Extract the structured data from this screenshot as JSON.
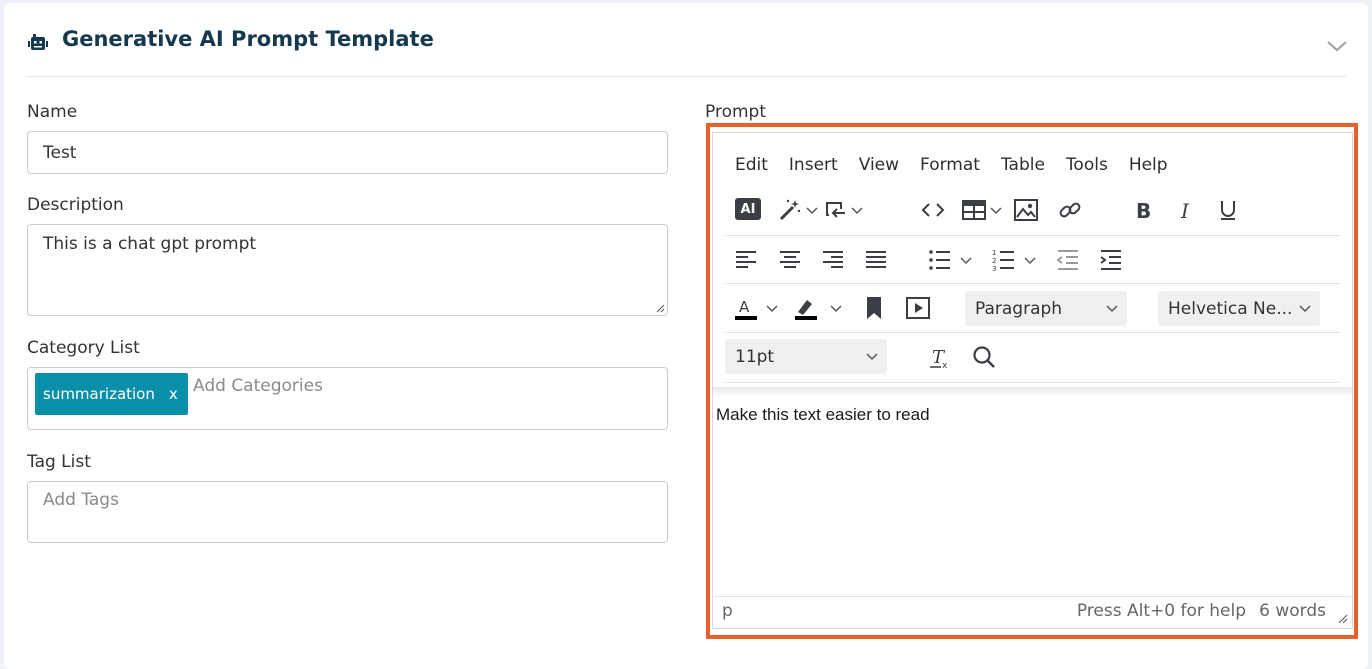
{
  "header": {
    "title": "Generative AI Prompt Template",
    "icon": "robot-icon"
  },
  "form": {
    "name_label": "Name",
    "name_value": "Test",
    "description_label": "Description",
    "description_value": "This is a chat gpt prompt",
    "category_label": "Category List",
    "category_chip": "summarization",
    "category_chip_remove": "x",
    "category_placeholder": "Add Categories",
    "tag_label": "Tag List",
    "tag_placeholder": "Add Tags",
    "prompt_label": "Prompt"
  },
  "editor": {
    "menu": [
      "Edit",
      "Insert",
      "View",
      "Format",
      "Table",
      "Tools",
      "Help"
    ],
    "ai_label": "AI",
    "block_format": "Paragraph",
    "font_family": "Helvetica Ne...",
    "font_size": "11pt",
    "content": "Make this text easier to read",
    "status_path": "p",
    "help_hint": "Press Alt+0 for help",
    "word_count": "6 words"
  },
  "colors": {
    "accent": "#e8612c",
    "chip": "#0a8fa8",
    "title": "#14394d"
  }
}
